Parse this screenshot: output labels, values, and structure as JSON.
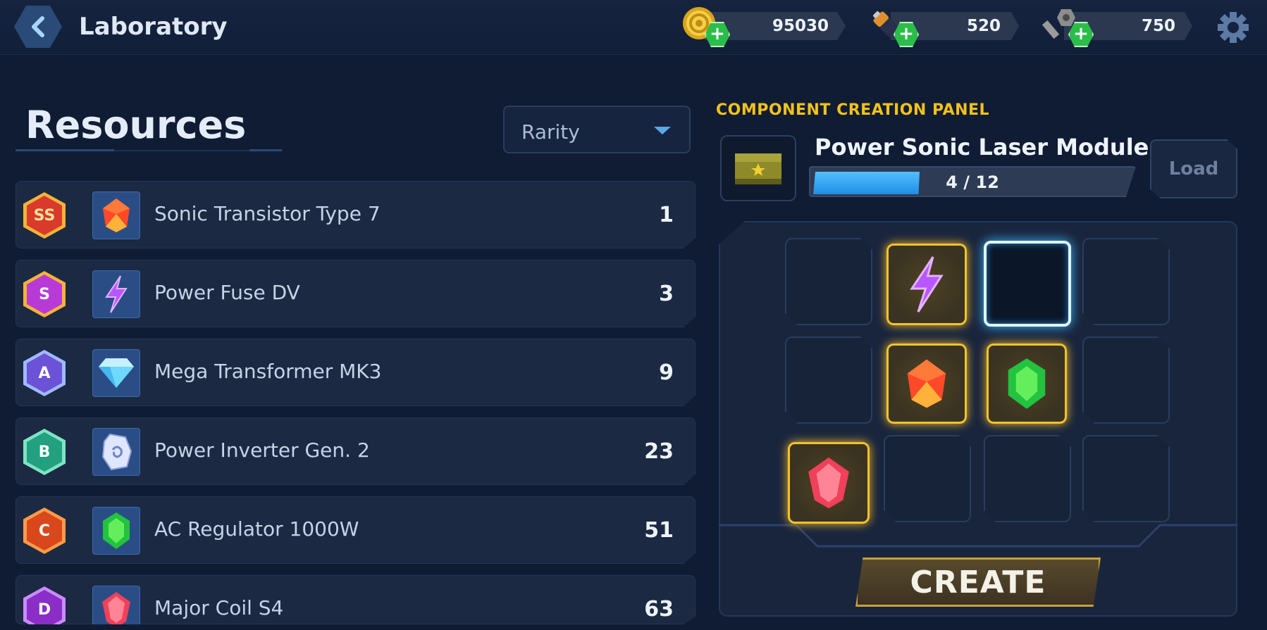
{
  "header": {
    "title": "Laboratory",
    "currencies": [
      {
        "name": "coins-icon",
        "amount": "95030"
      },
      {
        "name": "battery-icon",
        "amount": "520"
      },
      {
        "name": "bolt-nut-icon",
        "amount": "750"
      }
    ]
  },
  "resources": {
    "title": "Resources",
    "sort": {
      "selected": "Rarity"
    },
    "items": [
      {
        "rank": "SS",
        "name": "Sonic Transistor Type 7",
        "count": "1"
      },
      {
        "rank": "S",
        "name": "Power Fuse DV",
        "count": "3"
      },
      {
        "rank": "A",
        "name": "Mega Transformer MK3",
        "count": "9"
      },
      {
        "rank": "B",
        "name": "Power Inverter Gen. 2",
        "count": "23"
      },
      {
        "rank": "C",
        "name": "AC Regulator 1000W",
        "count": "51"
      },
      {
        "rank": "D",
        "name": "Major Coil S4",
        "count": "63"
      }
    ]
  },
  "panel": {
    "label": "COMPONENT CREATION PANEL",
    "module_name": "Power Sonic Laser Module",
    "progress_text": "4 / 12",
    "progress_value": 4,
    "progress_max": 12,
    "load_label": "Load",
    "create_label": "CREATE"
  },
  "colors": {
    "gold": "#f2c21b",
    "progress_blue": "#3aa8f5",
    "slot_highlight": "#f0c32b"
  }
}
